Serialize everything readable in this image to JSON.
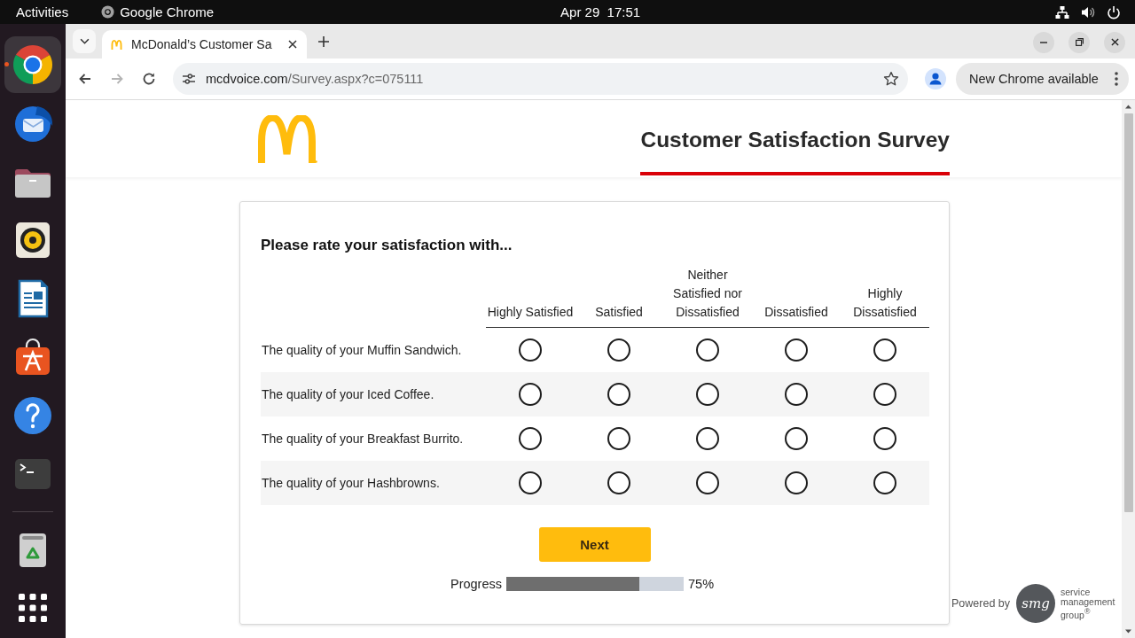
{
  "topbar": {
    "activities": "Activities",
    "app_name": "Google Chrome",
    "clock": "Apr 29  17:51"
  },
  "dock": {
    "items": [
      {
        "selected": true
      },
      {
        "selected": false
      },
      {
        "selected": false
      },
      {
        "selected": false
      },
      {
        "selected": false
      },
      {
        "selected": false
      },
      {
        "selected": false
      },
      {
        "selected": false
      },
      {
        "selected": false
      }
    ]
  },
  "browser": {
    "tabs": [
      {
        "title": "McDonald’s Customer Sa",
        "selected": true
      }
    ],
    "forward_button": {
      "disabled": true
    },
    "url": {
      "host": "mcdvoice.com",
      "path": "/Survey.aspx?c=075111"
    },
    "update_chip": "New Chrome available"
  },
  "survey": {
    "title": "Customer Satisfaction Survey",
    "question": "Please rate your satisfaction with...",
    "columns": [
      "Highly Satisfied",
      "Satisfied",
      "Neither Satisfied nor Dissatisfied",
      "Dissatisfied",
      "Highly Dissatisfied"
    ],
    "rows": [
      {
        "label": "The quality of your Muffin Sandwich.",
        "choices": [
          {
            "selected": false
          },
          {
            "selected": false
          },
          {
            "selected": false
          },
          {
            "selected": false
          },
          {
            "selected": false
          }
        ]
      },
      {
        "label": "The quality of your Iced Coffee.",
        "choices": [
          {
            "selected": false
          },
          {
            "selected": false
          },
          {
            "selected": false
          },
          {
            "selected": false
          },
          {
            "selected": false
          }
        ]
      },
      {
        "label": "The quality of your Breakfast Burrito.",
        "choices": [
          {
            "selected": false
          },
          {
            "selected": false
          },
          {
            "selected": false
          },
          {
            "selected": false
          },
          {
            "selected": false
          }
        ]
      },
      {
        "label": "The quality of your Hashbrowns.",
        "choices": [
          {
            "selected": false
          },
          {
            "selected": false
          },
          {
            "selected": false
          },
          {
            "selected": false
          },
          {
            "selected": false
          }
        ]
      }
    ],
    "next_button": "Next",
    "progress": {
      "label": "Progress",
      "level": 0.75,
      "reading": "75%"
    }
  },
  "footer": {
    "powered_by": "Powered by",
    "logo_text": "smg",
    "company_lines": [
      "service",
      "management",
      "group$^{®}$"
    ]
  }
}
